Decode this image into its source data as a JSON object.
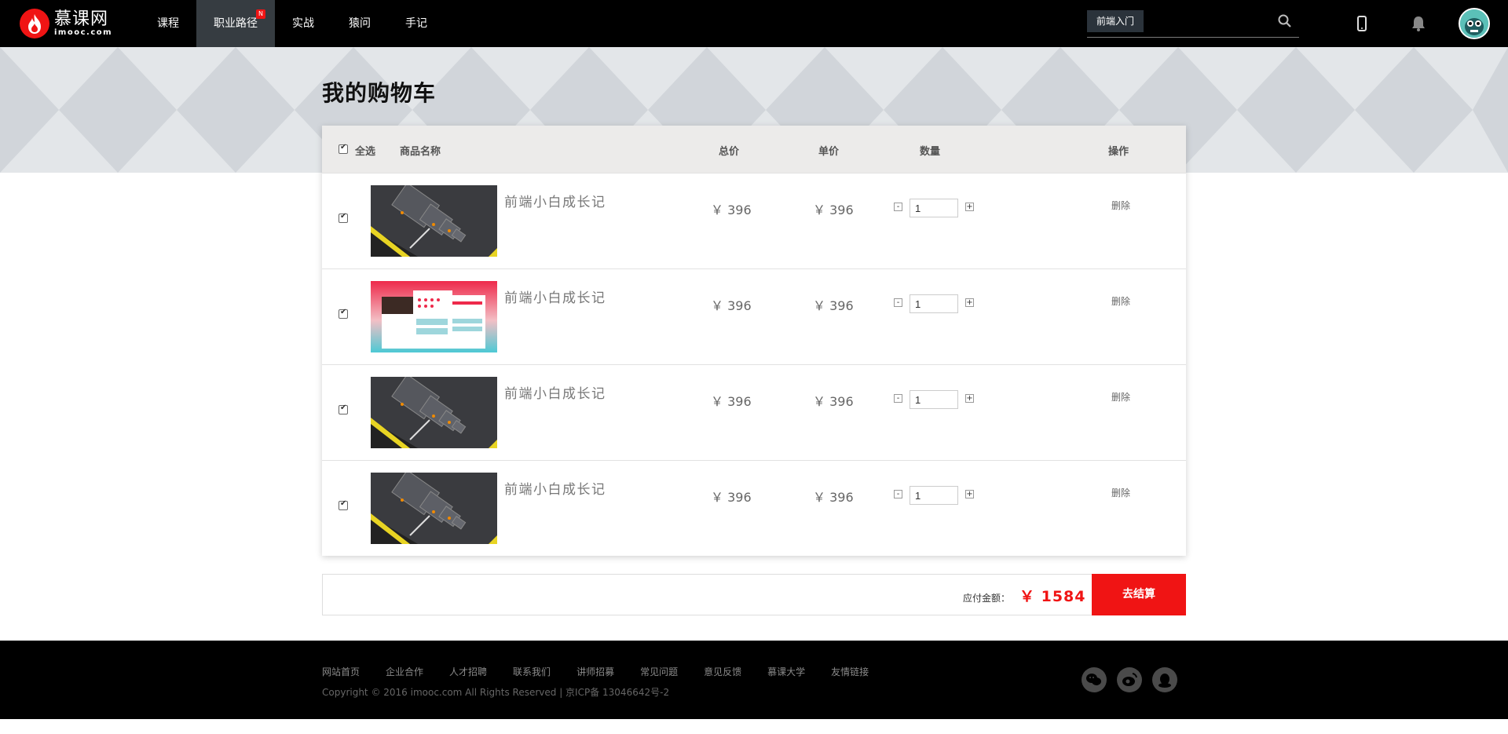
{
  "header": {
    "logo_cn": "慕课网",
    "logo_en": "imooc.com",
    "nav": [
      {
        "label": "课程"
      },
      {
        "label": "职业路径",
        "badge": "N"
      },
      {
        "label": "实战"
      },
      {
        "label": "猿问"
      },
      {
        "label": "手记"
      }
    ],
    "search_tag": "前端入门",
    "search_placeholder": ""
  },
  "page": {
    "title": "我的购物车"
  },
  "cart": {
    "headers": {
      "select_all": "全选",
      "name": "商品名称",
      "total": "总价",
      "unit": "单价",
      "qty": "数量",
      "action": "操作"
    },
    "items": [
      {
        "name": "前端小白成长记",
        "total": "￥ 396",
        "unit": "￥ 396",
        "qty": "1",
        "delete": "删除",
        "image": "dark-devices"
      },
      {
        "name": "前端小白成长记",
        "total": "￥ 396",
        "unit": "￥ 396",
        "qty": "1",
        "delete": "删除",
        "image": "pink-app-screens"
      },
      {
        "name": "前端小白成长记",
        "total": "￥ 396",
        "unit": "￥ 396",
        "qty": "1",
        "delete": "删除",
        "image": "dark-devices"
      },
      {
        "name": "前端小白成长记",
        "total": "￥ 396",
        "unit": "￥ 396",
        "qty": "1",
        "delete": "删除",
        "image": "dark-devices"
      }
    ],
    "minus": "-",
    "plus": "+"
  },
  "summary": {
    "label": "应付金额：",
    "amount": "￥ 1584",
    "checkout": "去结算"
  },
  "footer": {
    "links": [
      "网站首页",
      "企业合作",
      "人才招聘",
      "联系我们",
      "讲师招募",
      "常见问题",
      "意见反馈",
      "慕课大学",
      "友情链接"
    ],
    "copyright": "Copyright © 2016 imooc.com All Rights Reserved | 京ICP备 13046642号-2"
  },
  "colors": {
    "accent": "#f01414",
    "header_bg": "#000000",
    "nav_active": "#363c41"
  }
}
